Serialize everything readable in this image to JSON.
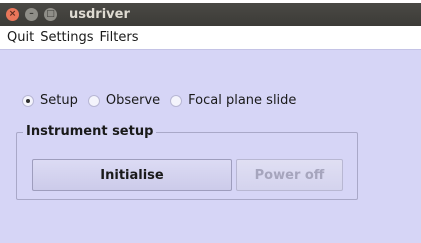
{
  "window": {
    "title": "usdriver"
  },
  "menubar": {
    "items": [
      "Quit",
      "Settings",
      "Filters"
    ]
  },
  "mode": {
    "options": [
      "Setup",
      "Observe",
      "Focal plane slide"
    ],
    "selected": "Setup"
  },
  "instrument_setup": {
    "title": "Instrument setup",
    "initialise_label": "Initialise",
    "power_off_label": "Power off",
    "power_off_enabled": false
  }
}
